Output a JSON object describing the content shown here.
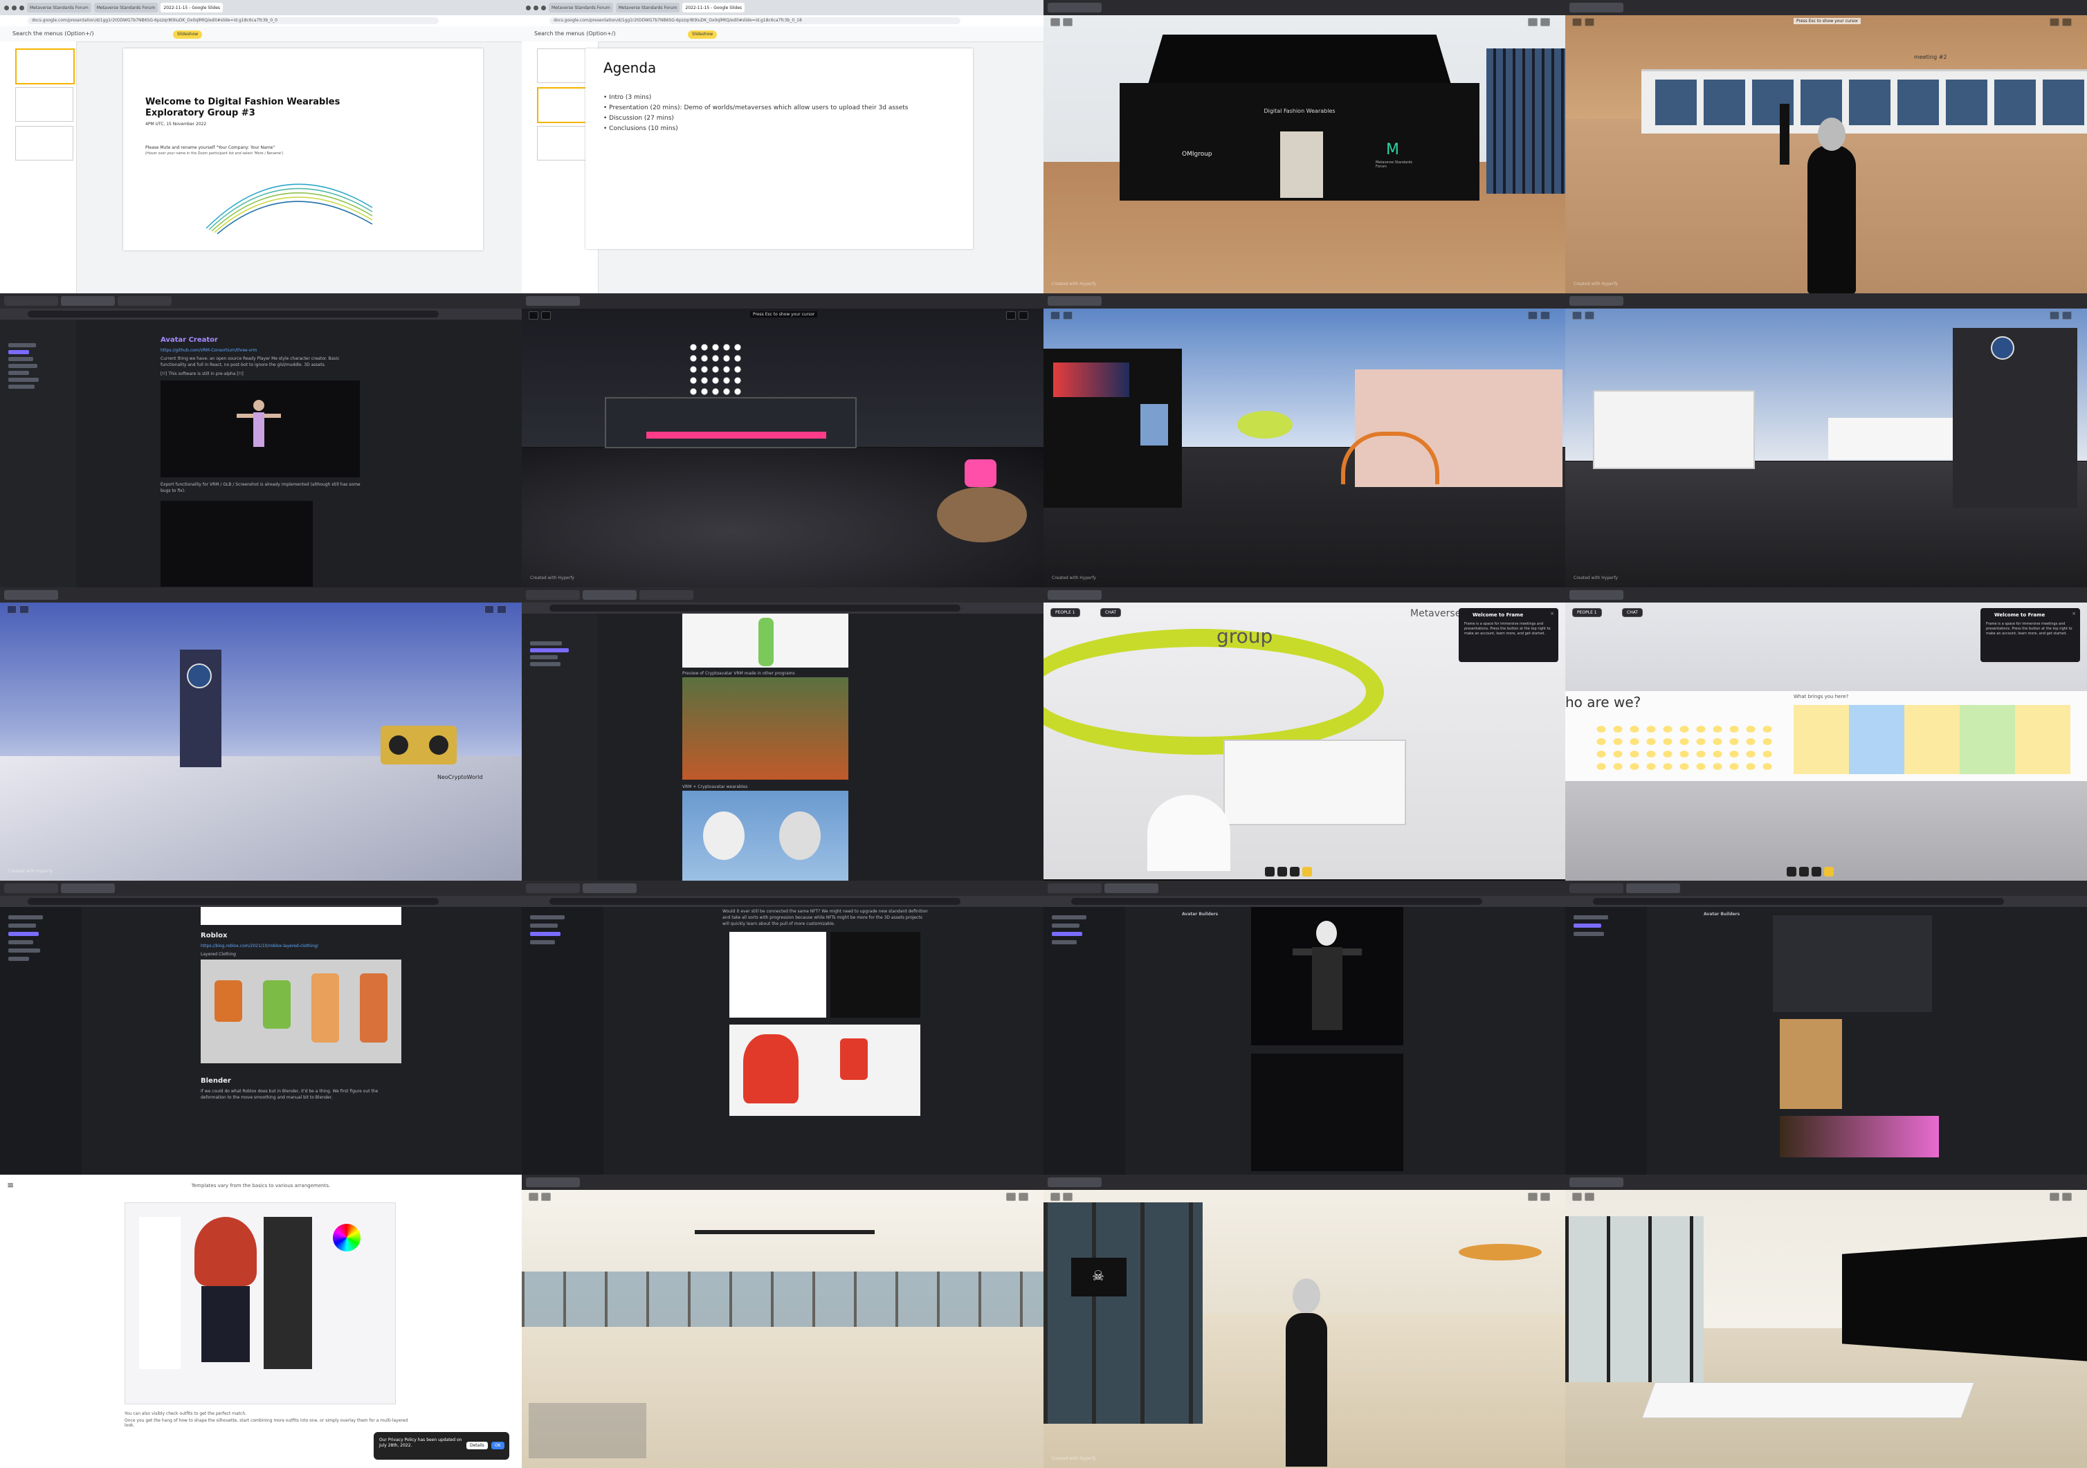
{
  "tiles": {
    "t1": {
      "tabs": [
        "Metaverse Standards Forum",
        "Metaverse Standards Forum",
        "2022-11-15 - Google Slides"
      ],
      "url": "docs.google.com/presentation/d/1gg1r2tODWG7b7NB6SG-6pzzqr8t9iuDK_Ox0qlMtQ/edit#slide=id.g18c6ca7fc3b_0_0",
      "search": "Search the menus (Option+/)",
      "share": "Slideshow",
      "slide_title_1": "Welcome to Digital Fashion Wearables",
      "slide_title_2": "Exploratory Group #3",
      "slide_date": "4PM UTC, 15 November 2022",
      "slide_note_1": "Please Mute and rename yourself \"Your Company: Your Name\"",
      "slide_note_2": "(Hover over your name in the Zoom participant list and select 'More / Rename')"
    },
    "t2": {
      "tabs": [
        "Metaverse Standards Forum",
        "Metaverse Standards Forum",
        "2022-11-15 - Google Slides"
      ],
      "url": "docs.google.com/presentation/d/1gg1r2tODWG7b7NB6SG-6pzzqr8t9iuDK_Ox0qlMtQ/edit#slide=id.g18c6ca7fc3b_0_18",
      "search": "Search the menus (Option+/)",
      "share": "Slideshow",
      "agenda_title": "Agenda",
      "agenda_items": [
        "Intro (3 mins)",
        "Presentation (20 mins): Demo of worlds/metaverses which allow users to upload their 3d assets",
        "Discussion (27 mins)",
        "Conclusions (10 mins)"
      ]
    },
    "t3": {
      "sign": "Digital Fashion Wearables",
      "logo_left": "OMIgroup",
      "logo_right": "Metaverse Standards Forum",
      "watermark": "Created with Hyperfy"
    },
    "t4": {
      "sign": "meeting #2",
      "hint": "Press  Esc  to show your cursor",
      "watermark": "Created with Hyperfy"
    },
    "t5": {
      "heading": "Avatar Creator",
      "link": "https://github.com/VRM-Consortium/three-vrm",
      "para": "Current thing we have: an open source Ready Player Me style character creator. Basic functionality and full in React, no post-bot to ignore the glsl/muddle. 3D assets.",
      "note": "[!!] This software is still in pre-alpha [!!]",
      "para2": "Export functionality for VRM / GLB / Screenshot is already implemented (although still has some bugs to fix)."
    },
    "t6": {
      "hint": "Press  Esc  to show your cursor",
      "watermark": "Created with Hyperfy"
    },
    "t7": {
      "watermark": "Created with Hyperfy"
    },
    "t8": {
      "watermark": "Created with Hyperfy"
    },
    "t9": {
      "sign": "NeoCryptoWorld",
      "watermark": "Created with Hyperfy"
    },
    "t10": {
      "caption_1": "Preview of Cryptoavatar VRM made in other programs",
      "caption_2": "VRM + Cryptoavatar wearables"
    },
    "t11": {
      "people": "PEOPLE 1",
      "chat": "CHAT",
      "sign_left": "group",
      "sign_right": "Metaverse STANDARDS F",
      "welcome_title": "Welcome to Frame",
      "welcome_body": "Frame is a space for immersive meetings and presentations. Press the button at the top right to make an account, learn more, and get started."
    },
    "t12": {
      "people": "PEOPLE 1",
      "chat": "CHAT",
      "board_title": "ho are we?",
      "board_sub": "What brings you here?",
      "welcome_title": "Welcome to Frame",
      "welcome_body": "Frame is a space for immersive meetings and presentations. Press the button at the top right to make an account, learn more, and get started."
    },
    "t13": {
      "heading": "Roblox",
      "link": "https://blog.roblox.com/2021/10/roblox-layered-clothing/",
      "sub": "Layered Clothing",
      "heading2": "Blender",
      "para": "If we could do what Roblox does but in Blender, it'd be a thing. We first figure out the deformation to the move smoothing and manual bit to Blender."
    },
    "t14": {
      "para": "Would it ever still be connected the same NFT? We might need to upgrade new standard definition and take all sorts with progression because while NFTs might be more for the 3D assets projects will quickly learn about the pull of more customizable."
    },
    "t15": {
      "heading": "Avatar Builders"
    },
    "t16": {
      "heading": "Avatar Builders"
    },
    "t17": {
      "top": "Templates vary from the basics to various arrangements.",
      "bottom_1": "You can also visibly check outfits to get the perfect match.",
      "bottom_2": "Once you get the hang of how to shape the silhouette, start combining more outfits into one, or simply overlay them for a multi-layered look.",
      "privacy": "Our Privacy Policy has been updated on July 28th, 2022.",
      "privacy_btn_1": "Details",
      "privacy_btn_2": "OK"
    },
    "t18": {
      "watermark": ""
    },
    "t19": {
      "watermark": "Created with Hyperfy"
    },
    "t20": {
      "watermark": ""
    }
  },
  "colors": {
    "slides_accent": "#f4b400",
    "doc_accent": "#a48bff",
    "link": "#5da9ff",
    "frame_panel": "#1b1b1f"
  }
}
